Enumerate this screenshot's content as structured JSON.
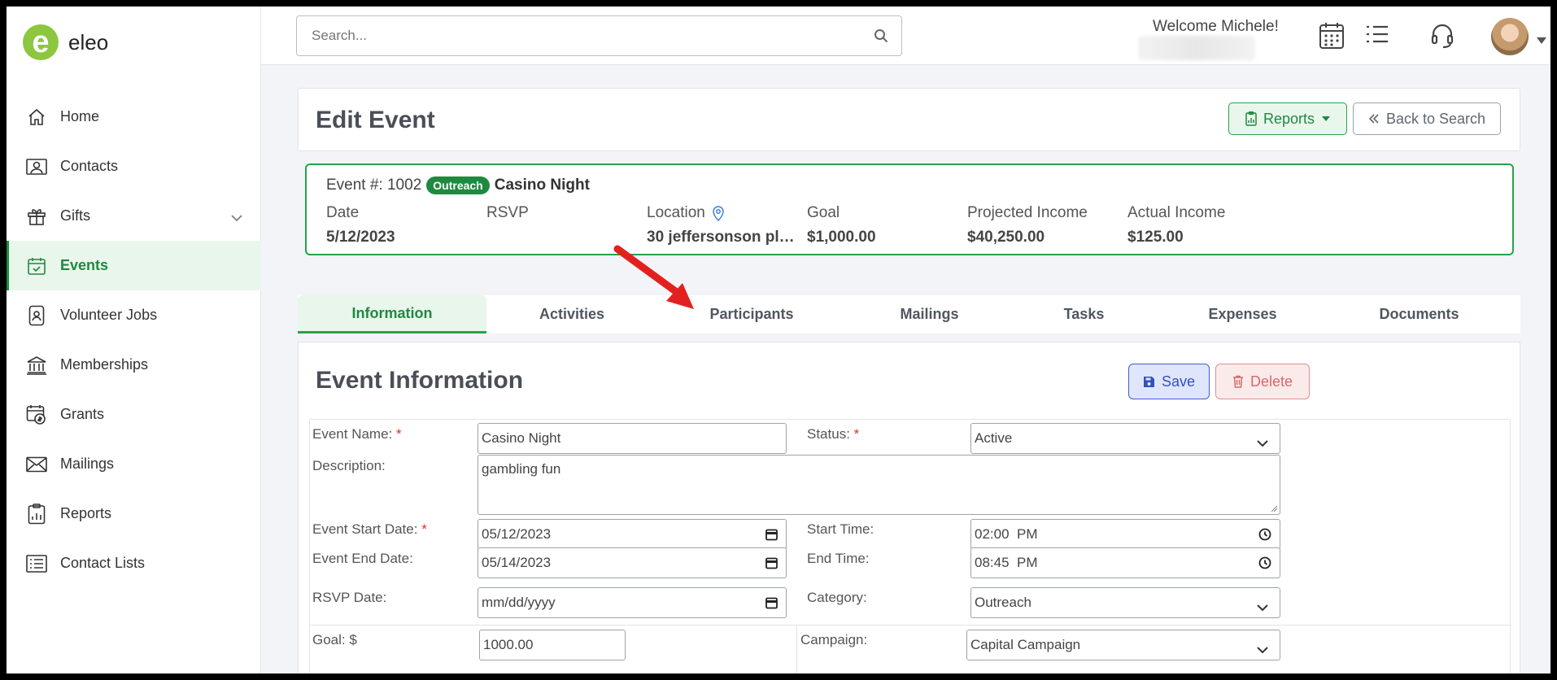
{
  "app": {
    "name": "eleo",
    "logo_letter": "e",
    "brand_color": "#8dc63f",
    "accent_color": "#1e8a3f"
  },
  "sidebar": {
    "items": [
      {
        "label": "Home",
        "icon": "home-icon"
      },
      {
        "label": "Contacts",
        "icon": "contacts-icon"
      },
      {
        "label": "Gifts",
        "icon": "gift-icon"
      },
      {
        "label": "Events",
        "icon": "calendar-check-icon",
        "active": true
      },
      {
        "label": "Volunteer Jobs",
        "icon": "badge-icon"
      },
      {
        "label": "Memberships",
        "icon": "bank-icon"
      },
      {
        "label": "Grants",
        "icon": "grants-icon"
      },
      {
        "label": "Mailings",
        "icon": "envelope-icon"
      },
      {
        "label": "Reports",
        "icon": "clipboard-chart-icon"
      },
      {
        "label": "Contact Lists",
        "icon": "list-icon"
      }
    ]
  },
  "topbar": {
    "search_placeholder": "Search...",
    "welcome": "Welcome Michele!"
  },
  "header": {
    "title": "Edit Event",
    "reports_label": "Reports",
    "back_label": "Back to Search"
  },
  "event": {
    "number_label": "Event #: 1002",
    "badge": "Outreach",
    "name": "Casino Night",
    "date_label": "Date",
    "date": "5/12/2023",
    "rsvp_label": "RSVP",
    "rsvp": "",
    "location_label": "Location",
    "location": "30 jeffersonson plaz...",
    "goal_label": "Goal",
    "goal": "$1,000.00",
    "projected_label": "Projected Income",
    "projected": "$40,250.00",
    "actual_label": "Actual Income",
    "actual": "$125.00"
  },
  "tabs": [
    "Information",
    "Activities",
    "Participants",
    "Mailings",
    "Tasks",
    "Expenses",
    "Documents"
  ],
  "form": {
    "title": "Event Information",
    "save_label": "Save",
    "delete_label": "Delete",
    "event_name_label": "Event Name:",
    "event_name": "Casino Night",
    "status_label": "Status:",
    "status": "Active",
    "description_label": "Description:",
    "description": "gambling fun",
    "start_date_label": "Event Start Date:",
    "start_date": "05/12/2023",
    "start_time_label": "Start Time:",
    "start_time": "02:00  PM",
    "end_date_label": "Event End Date:",
    "end_date": "05/14/2023",
    "end_time_label": "End Time:",
    "end_time": "08:45  PM",
    "rsvp_date_label": "RSVP Date:",
    "rsvp_date": "mm/dd/yyyy",
    "category_label": "Category:",
    "category": "Outreach",
    "goal_label": "Goal: $",
    "goal": "1000.00",
    "campaign_label": "Campaign:",
    "campaign": "Capital Campaign",
    "required_mark": "*"
  }
}
